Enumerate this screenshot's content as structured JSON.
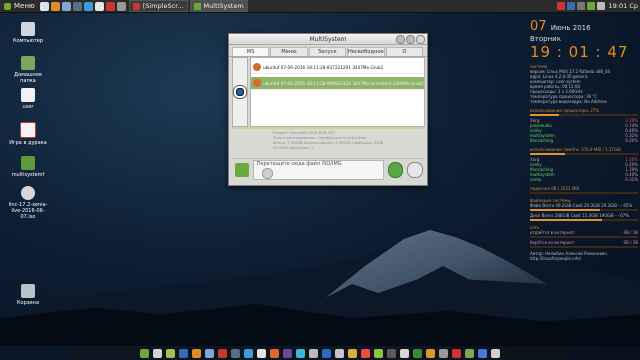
{
  "top_panel": {
    "menu_label": "Меню",
    "tasks": [
      {
        "label": "[SimpleScr...",
        "active": false
      },
      {
        "label": "MultiSystem",
        "active": true
      }
    ],
    "clock": "19:01 Ср"
  },
  "desktop": {
    "icons": [
      {
        "label": "Компьютер"
      },
      {
        "label": "Домашняя папка"
      },
      {
        "label": "user"
      },
      {
        "label": "Игра в дурака"
      },
      {
        "label": "multisystemf"
      },
      {
        "label": "linc-17.2-xenia-live-2016-06-07.iso"
      },
      {
        "label": "Корзина"
      }
    ]
  },
  "conky": {
    "day": "07",
    "month_year": "Июнь 2016",
    "weekday": "Вторник",
    "time": "19 : 01 : 47",
    "system_lines": [
      "система",
      "версия: Linux Mint 17.2 Rafaela x86_64",
      "ядро: Linux 4.2.0-35-generic",
      "компьютер: user-system",
      "время работы: 00:15:00",
      "процессоры: 2 x 2.60GHz",
      "температура процессора: 36 °C",
      "температура видеоядра: No Address"
    ],
    "cpu_title": "использование процессора: 27%",
    "cpu_rows": [
      [
        "Xorg",
        "3.29%"
      ],
      [
        "pulseaudio",
        "0.74%"
      ],
      [
        "conky",
        "0.46%"
      ],
      [
        "multisystem",
        "0.32%"
      ],
      [
        "lfoncaching",
        "0.20%"
      ]
    ],
    "mem_title": "использование памяти: 376.9 MiB  / 1.17GiB",
    "mem_rows": [
      [
        "Xorg",
        "1.36%"
      ],
      [
        "conky",
        "0.20%"
      ],
      [
        "lfoncaching",
        "1.19%"
      ],
      [
        "multisystem",
        "0.40%"
      ],
      [
        "nemo",
        "0.31%"
      ]
    ],
    "swap_title": "подкачка 0B / 1022 MiB",
    "disk_title": "файловые системы",
    "disk_lines": [
      "Файл Всего 49.2GiB Своб 20.3GiB 29.3GiB  ···  65%",
      "Диск Всего 286GiB Своб 15.3GiB 190GiB  ···  67%"
    ],
    "net_title": "сеть",
    "net_rows": [
      [
        "отдаётся в интернет:",
        "0B  / 1B"
      ],
      [
        "берётся из интернет:",
        "0B  / 1B"
      ]
    ],
    "footer": [
      "Автор: Нелюбин Алексей Романович",
      "http://linuxforpeople.info/"
    ]
  },
  "window": {
    "title": "MultiSystem",
    "tabs": [
      "MS",
      "Меню",
      "Запуск",
      "Несвободное ПО",
      "О программе"
    ],
    "entries": [
      {
        "text": "ubuntuf   07-06-2016-18:11:28-837221291   3447Mo     Grub2",
        "selected": false
      },
      {
        "text": "ubuntuf   07-06-2016-18:11:28-999522324   3447Mo   persistent 2200Mo   Grub2",
        "selected": true
      }
    ],
    "info_lines": [
      "Раздел: /dev/sdf1 USB 8GB FAT",
      "Точка монтирования: /media/user/multisystem",
      "Всего: 7.96GiB Использовано: 2.98GiB Свободно: 5GiB",
      "ISO/IMG обрезано: 2"
    ],
    "drop_placeholder": "Перетащите сюда файл ISO/IMG"
  },
  "colors": {
    "accent_orange": "#e0932e",
    "selection_green": "#8fb36a"
  }
}
